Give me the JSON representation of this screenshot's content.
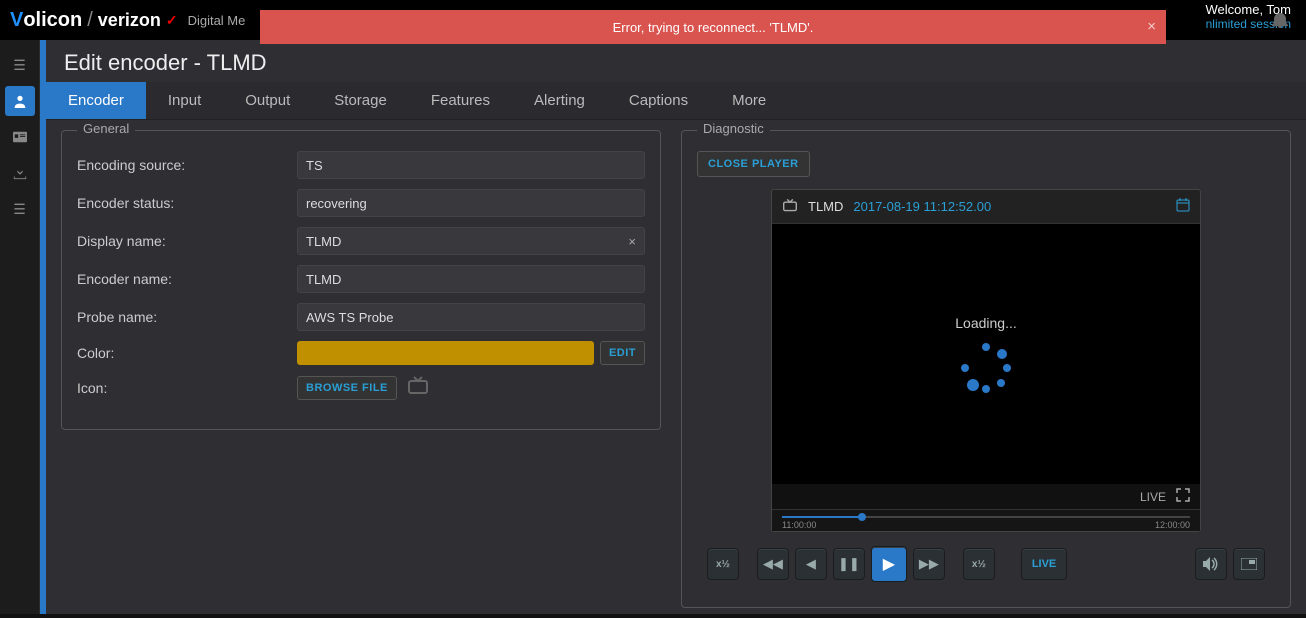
{
  "brand": {
    "name1_prefix": "V",
    "name1_rest": "olicon",
    "name2": "verizon",
    "suffix": "Digital Me"
  },
  "topright": {
    "welcome": "Welcome, Tom",
    "session": "nlimited session"
  },
  "error": {
    "message": "Error, trying to reconnect... 'TLMD'."
  },
  "page": {
    "title": "Edit encoder - TLMD"
  },
  "tabs": [
    "Encoder",
    "Input",
    "Output",
    "Storage",
    "Features",
    "Alerting",
    "Captions",
    "More"
  ],
  "general": {
    "legend": "General",
    "encoding_source_label": "Encoding source:",
    "encoding_source": "TS",
    "encoder_status_label": "Encoder status:",
    "encoder_status": "recovering",
    "display_name_label": "Display name:",
    "display_name": "TLMD",
    "encoder_name_label": "Encoder name:",
    "encoder_name": "TLMD",
    "probe_name_label": "Probe name:",
    "probe_name": "AWS TS Probe",
    "color_label": "Color:",
    "color_value": "#c09000",
    "edit_btn": "EDIT",
    "icon_label": "Icon:",
    "browse_btn": "BROWSE FILE"
  },
  "diagnostic": {
    "legend": "Diagnostic",
    "close_player": "CLOSE PLAYER",
    "player_name": "TLMD",
    "player_timestamp": "2017-08-19 11:12:52.00",
    "loading": "Loading...",
    "live": "LIVE",
    "timeline_start": "11:00:00",
    "timeline_end": "12:00:00",
    "speed_down": "x½",
    "speed_up": "x½",
    "live_btn": "LIVE"
  }
}
